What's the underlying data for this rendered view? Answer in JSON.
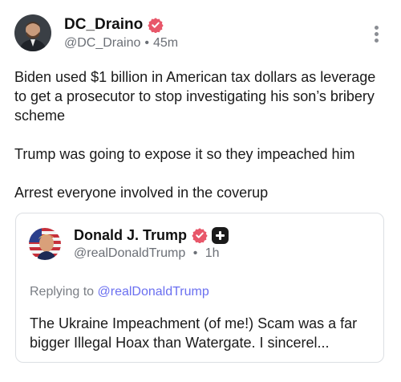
{
  "post": {
    "author": {
      "display_name": "DC_Draino",
      "handle": "@DC_Draino",
      "time": "45m",
      "verified_icon": "verified-badge-icon"
    },
    "paragraphs": [
      "Biden used $1 billion in American tax dollars as leverage to get a prosecutor to stop investigating his son’s bribery scheme",
      "Trump was going to expose it so they impeached him",
      "Arrest everyone involved in the coverup"
    ],
    "menu_icon": "more-vertical-icon"
  },
  "quote": {
    "author": {
      "display_name": "Donald J. Trump",
      "handle": "@realDonaldTrump",
      "time": "1h",
      "verified_icon": "verified-badge-icon",
      "plus_icon": "plus-badge-icon"
    },
    "replying_prefix": "Replying to",
    "replying_to": "@realDonaldTrump",
    "text": "The Ukraine Impeachment (of me!) Scam was a far bigger Illegal Hoax than Watergate. I sincerel..."
  },
  "colors": {
    "verified": "#e8576a",
    "link": "#6a6ff0",
    "muted": "#6b6f76",
    "border": "#dcdfe3"
  }
}
